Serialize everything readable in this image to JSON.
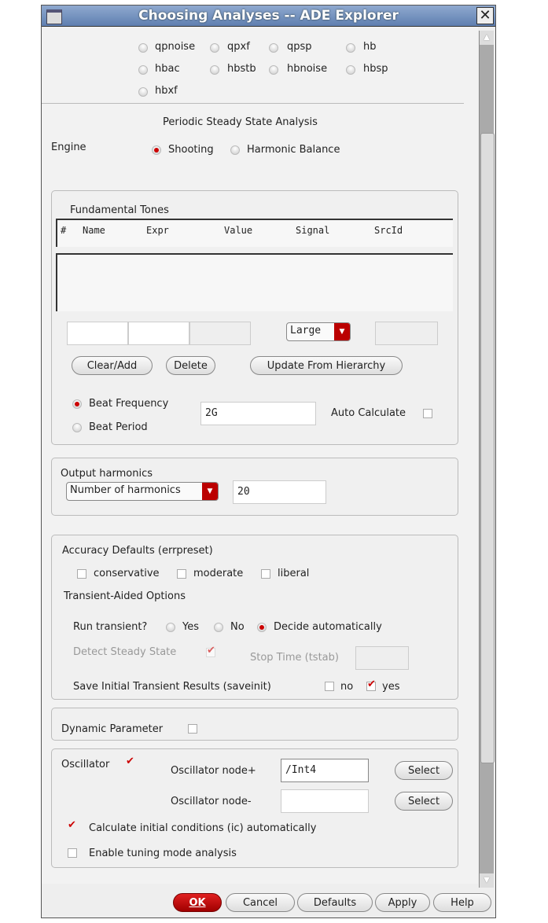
{
  "window": {
    "title": "Choosing Analyses -- ADE Explorer"
  },
  "analyses": [
    "qpnoise",
    "qpxf",
    "qpsp",
    "hb",
    "hbac",
    "hbstb",
    "hbnoise",
    "hbsp",
    "hbxf"
  ],
  "pss": {
    "heading": "Periodic Steady State Analysis",
    "engine_label": "Engine",
    "engine_options": [
      "Shooting",
      "Harmonic Balance"
    ],
    "engine_selected": "Shooting"
  },
  "tones": {
    "title": "Fundamental Tones",
    "columns": [
      "#",
      "Name",
      "Expr",
      "Value",
      "Signal",
      "SrcId"
    ],
    "signal_select": "Large",
    "clear_add": "Clear/Add",
    "delete": "Delete",
    "update": "Update From Hierarchy",
    "beat_frequency": "Beat Frequency",
    "beat_period": "Beat Period",
    "beat_value": "2G",
    "auto_calculate": "Auto Calculate"
  },
  "harmonics": {
    "title": "Output harmonics",
    "select": "Number of harmonics",
    "value": "20"
  },
  "accuracy": {
    "title": "Accuracy Defaults (errpreset)",
    "options": [
      "conservative",
      "moderate",
      "liberal"
    ],
    "transient_title": "Transient-Aided Options",
    "run_transient": "Run transient?",
    "run_options": [
      "Yes",
      "No",
      "Decide automatically"
    ],
    "run_selected": "Decide automatically",
    "detect_steady": "Detect Steady State",
    "stop_time": "Stop Time (tstab)",
    "save_initial": "Save Initial Transient Results (saveinit)",
    "save_no": "no",
    "save_yes": "yes"
  },
  "dynamic": {
    "label": "Dynamic Parameter"
  },
  "oscillator": {
    "label": "Oscillator",
    "node_plus_label": "Oscillator node+",
    "node_plus": "/Int4",
    "node_minus_label": "Oscillator node-",
    "node_minus": "",
    "select": "Select",
    "calc_ic": "Calculate initial conditions (ic) automatically",
    "tuning": "Enable tuning mode analysis"
  },
  "buttons": {
    "ok": "OK",
    "cancel": "Cancel",
    "defaults": "Defaults",
    "apply": "Apply",
    "help": "Help"
  },
  "colors": {
    "accent": "#cc0000",
    "titlebar": "#6f8dbd"
  }
}
